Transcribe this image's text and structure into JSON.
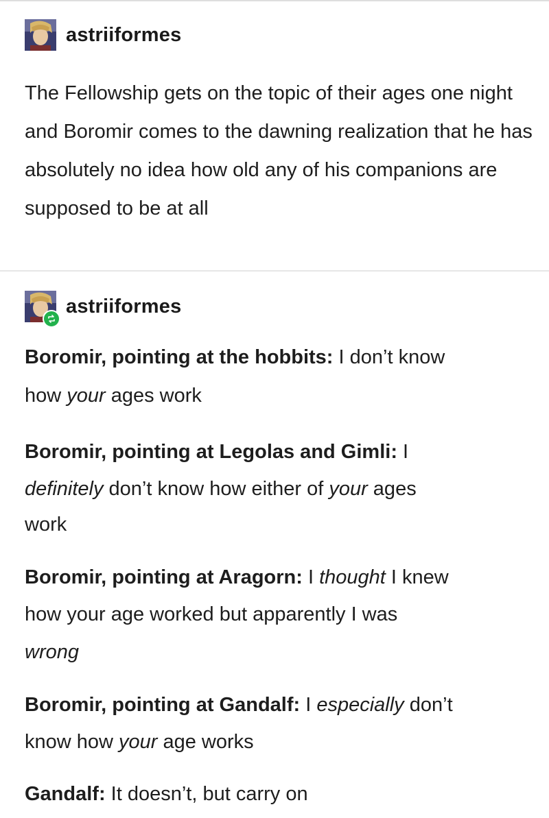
{
  "post1": {
    "username": "astriiformes",
    "text": "The Fellowship gets on the topic of their ages one night and Boromir comes to the dawning realization that he has absolutely no idea how old any of his companions are supposed to be at all"
  },
  "post2": {
    "username": "astriiformes",
    "hobbits": {
      "speaker": "Boromir, pointing at the hobbits:",
      "t1": " I don’t know",
      "t2": "how ",
      "em1": "your",
      "t3": " ages work"
    },
    "legolas": {
      "speaker": "Boromir, pointing at Legolas and Gimli:",
      "t1": " I",
      "em1": "definitely",
      "t2": " don’t know how either of ",
      "em2": "your",
      "t3": " ages",
      "t4": "work"
    },
    "aragorn": {
      "speaker": "Boromir, pointing at Aragorn:",
      "t1": " I ",
      "em1": "thought",
      "t2": " I knew",
      "t3": "how your age worked but apparently I was",
      "em2": "wrong"
    },
    "gandalf": {
      "speaker": "Boromir, pointing at Gandalf:",
      "t1": " I ",
      "em1": "especially",
      "t2": " don’t",
      "t3": "know how ",
      "em2": "your",
      "t4": " age works"
    },
    "reply": {
      "speaker": "Gandalf:",
      "text": " It doesn’t, but carry on"
    }
  },
  "colors": {
    "reblog_badge": "#22b14c",
    "text": "#1d1d1d"
  },
  "icons": {
    "avatar": "avatar-icon",
    "reblog": "reblog-icon"
  }
}
